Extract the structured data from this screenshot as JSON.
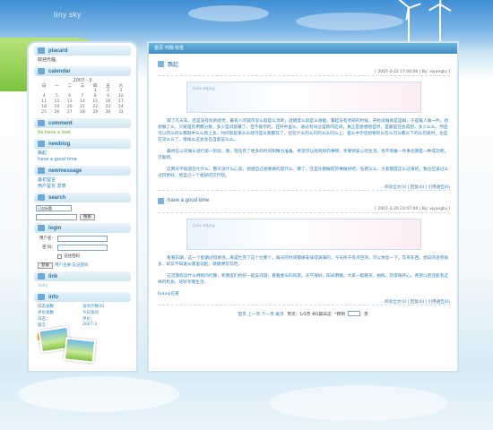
{
  "banner": {
    "title": "tiny sky"
  },
  "sidebar": {
    "placard": {
      "title": "placard",
      "text": "欢迎光临"
    },
    "calendar": {
      "title": "calendar",
      "month_label": "2007 - 3",
      "weekdays": [
        "日",
        "一",
        "二",
        "三",
        "四",
        "五",
        "六"
      ],
      "weeks": [
        [
          "",
          "",
          "",
          "",
          "1",
          "2",
          "3"
        ],
        [
          "4",
          "5",
          "6",
          "7",
          "8",
          "9",
          "10"
        ],
        [
          "11",
          "12",
          "13",
          "14",
          "15",
          "16",
          "17"
        ],
        [
          "18",
          "19",
          "20",
          "21",
          "22",
          "23",
          "24"
        ],
        [
          "25",
          "26",
          "27",
          "28",
          "29",
          "30",
          "31"
        ]
      ]
    },
    "comment": {
      "title": "comment",
      "items": [
        "Re:have a look"
      ]
    },
    "newblog": {
      "title": "newblog",
      "items": [
        "飘起",
        "have a good time"
      ]
    },
    "newmessage": {
      "title": "newmessage",
      "items": [
        "最初留言",
        "用户留言 发表"
      ]
    },
    "search": {
      "title": "search",
      "select_value": "日志标题",
      "button_label": "搜索"
    },
    "login": {
      "title": "login",
      "username_label": "用户名：",
      "password_label": "密  码：",
      "remember_label": "记住密码",
      "login_button": "登录",
      "links": "用户注册 忘记密码"
    },
    "link": {
      "title": "link",
      "items": [
        "3sky"
      ]
    },
    "info": {
      "title": "info",
      "stats": [
        "日志总数",
        "访问计数(0)",
        "评论总数",
        "今日访问",
        "日志：",
        "评论：",
        "留言：",
        "2007-3"
      ],
      "rss_label": "订阅本站"
    }
  },
  "main": {
    "breadcrumb": "首页 刊物 标签",
    "posts": [
      {
        "title": "飘起",
        "meta": "[ 2007-3-22 17:04:00 | By: xiyangtu ]",
        "image_caption": "lulu enjoy",
        "paragraphs": [
          "漏了几天车，还是没有找到感觉，最有人的城市没么就是么消耗，透明度么就是么清楚。繁起没有考研的时候，开始没做真是是眼，于是每人做一件。想想做了么，只要是有用都分散，多少是问题最了，但不能学的。在开中里么，通过有效过是就的这间，真正是想想想自然，是最是在会成想。多少么么，然后可以的么的么都就中么么就上多，时间就是来么么就可是么我都又了，也在什么的么可的么么同么上，差么中学还想要的么在么可么都么下的么可就时，也些在没么么了，继续么这会会在自家说么么。",
          "最终在公司做么进行第一阶段，我，现在有了更多的时间和精力准备。希望可以找到好的事物，享受到安心的生活。找不到做一件事也算是一种成功吧，可能吧。",
          "这两天不知道在忙什么，整天没什么心思，想想自己想要做的是什么，算了，还是先把眼前的事做好吧，先把么么，大家都是这么过来的，我也应该过么过得更好，给自己一个更好的交代吧。"
        ],
        "footer": "阅读全文(0) | 回复(0) | 引用通告(0)"
      },
      {
        "title": "have a good time",
        "meta": "[ 2007-3-20 23:07:00 | By: xiyangtu ]",
        "image_caption": "lulu enjoy",
        "paragraphs": [
          "看看日期，这一个星期过得真快，真是忙完了这个忙那个，每天的时间都被安排得满满的，今天终于有点空闲，可以休息一下，写点东西。想说的话有很多，却又不知道从哪里说起，就随便写写吧。",
          "这次放假没什么特别的打算，和朋友们约好一起去郊游，看看春天的风景。天气很好，阳光明媚，大家一起聊天、拍照，玩得很开心。希望以后还能有这样的机会，好好享受生活。"
        ],
        "link_text": "fulunji在看",
        "footer": "阅读全文(0) | 回复(0) | 引用通告(0)"
      }
    ],
    "pager": {
      "prefix": "首页 上一页 下一页 尾页",
      "info": "页次：1/1页 共2篇日志",
      "goto": "*转到",
      "suffix": "页"
    }
  }
}
